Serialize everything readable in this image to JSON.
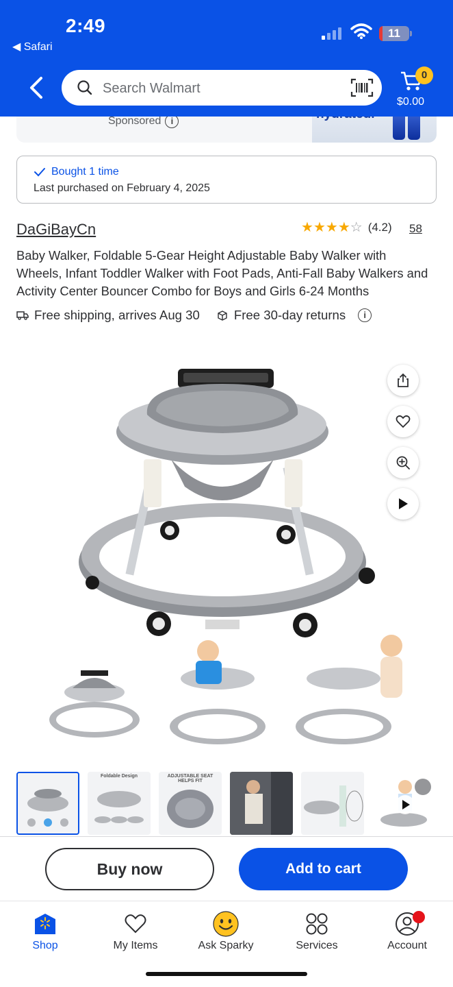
{
  "status_bar": {
    "time": "2:49",
    "back_app": "◀ Safari",
    "battery": "11",
    "battery_level": 0.11
  },
  "header": {
    "search_placeholder": "Search Walmart",
    "cart_count": "0",
    "cart_total": "$0.00"
  },
  "ad": {
    "sponsored_label": "Sponsored",
    "image_text": "hydrated."
  },
  "purchase_history": {
    "bought_label": "Bought 1 time",
    "last_purchased": "Last purchased on February 4, 2025"
  },
  "product": {
    "brand": "DaGiBayCn",
    "rating": 4.2,
    "rating_text": "(4.2)",
    "review_count": "58",
    "title": "Baby Walker, Foldable 5-Gear Height Adjustable Baby Walker with Wheels, Infant Toddler Walker with Foot Pads, Anti-Fall Baby Walkers and Activity Center Bouncer Combo for Boys and Girls 6-24 Months",
    "shipping": "Free shipping, arrives Aug 30",
    "returns": "Free 30-day returns"
  },
  "gallery": {
    "thumbnails": [
      {
        "name": "Walker overview"
      },
      {
        "name": "Foldable design",
        "label": "Foldable Design"
      },
      {
        "name": "Adjustable seat",
        "label": "ADJUSTABLE SEAT HELPS FIT"
      },
      {
        "name": "Lifestyle photo"
      },
      {
        "name": "Height adjustment"
      },
      {
        "name": "Video"
      }
    ]
  },
  "actions": {
    "buy_now": "Buy now",
    "add_to_cart": "Add to cart"
  },
  "tabs": [
    {
      "label": "Shop",
      "icon": "shop-icon"
    },
    {
      "label": "My Items",
      "icon": "heart-icon"
    },
    {
      "label": "Ask Sparky",
      "icon": "sparky-icon"
    },
    {
      "label": "Services",
      "icon": "services-icon"
    },
    {
      "label": "Account",
      "icon": "account-icon"
    }
  ],
  "colors": {
    "brand_blue": "#0A52E6",
    "star": "#F8A800",
    "cart_badge": "#FFC220",
    "notification": "#E5131A"
  }
}
